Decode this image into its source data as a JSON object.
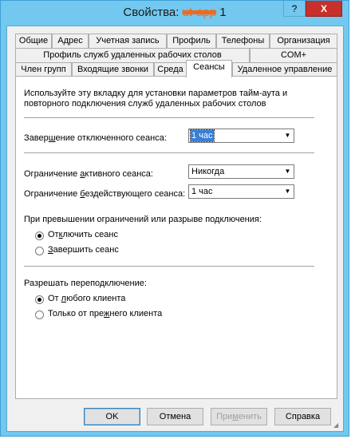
{
  "window": {
    "title_prefix": "Свойства: ",
    "title_redacted": "ut-app",
    "title_suffix": " 1",
    "help_glyph": "?",
    "close_glyph": "X"
  },
  "tabs_row1": [
    "Общие",
    "Адрес",
    "Учетная запись",
    "Профиль",
    "Телефоны",
    "Организация"
  ],
  "tabs_row2": [
    "Профиль служб удаленных рабочих столов",
    "COM+"
  ],
  "tabs_row3": [
    "Член групп",
    "Входящие звонки",
    "Среда",
    "Сеансы",
    "Удаленное управление"
  ],
  "active_tab": "Сеансы",
  "panel": {
    "description": "Используйте эту вкладку для установки параметров тайм-аута и повторного подключения служб удаленных рабочих столов",
    "end_disconnected": {
      "label_pre": "Завер",
      "label_u": "ш",
      "label_post": "ение отключенного сеанса:",
      "value": "1 час"
    },
    "active_limit": {
      "label_pre": "Ограничение ",
      "label_u": "а",
      "label_post": "ктивного сеанса:",
      "value": "Никогда"
    },
    "idle_limit": {
      "label_pre": "Ограничение ",
      "label_u": "б",
      "label_post": "ездействующего сеанса:",
      "value": "1 час"
    },
    "on_limit_label": "При превышении ограничений или разрыве подключения:",
    "on_limit_options": [
      {
        "pre": "От",
        "u": "к",
        "post": "лючить сеанс",
        "selected": true
      },
      {
        "pre": "",
        "u": "З",
        "post": "авершить сеанс",
        "selected": false
      }
    ],
    "reconnect_label": "Разрешать переподключение:",
    "reconnect_options": [
      {
        "pre": "От ",
        "u": "л",
        "post": "юбого клиента",
        "selected": true
      },
      {
        "pre": "Только от пре",
        "u": "ж",
        "post": "него клиента",
        "selected": false
      }
    ]
  },
  "buttons": {
    "ok": "OK",
    "cancel": "Отмена",
    "apply_pre": "При",
    "apply_u": "м",
    "apply_post": "енить",
    "help": "Справка"
  },
  "colors": {
    "frame": "#72c8ef",
    "close": "#c7302b",
    "selection": "#3a7fd5",
    "redaction": "#f06a1e"
  }
}
